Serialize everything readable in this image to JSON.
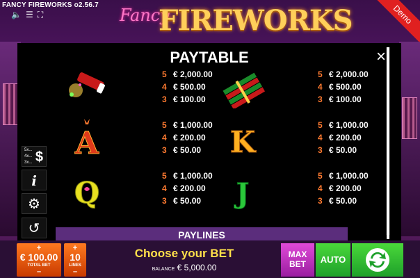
{
  "version": "FANCY FIREWORKS o2.56.7",
  "logo": {
    "fancy": "Fancy",
    "main": "FIREWORKS"
  },
  "demo": "Demo",
  "paytable": {
    "title": "PAYTABLE",
    "close": "×",
    "entries": [
      {
        "symbol": "firecracker",
        "pays": [
          {
            "n": "5",
            "amt": "€ 2,000.00"
          },
          {
            "n": "4",
            "amt": "€ 500.00"
          },
          {
            "n": "3",
            "amt": "€ 100.00"
          }
        ]
      },
      {
        "symbol": "rocket-bundle",
        "pays": [
          {
            "n": "5",
            "amt": "€ 2,000.00"
          },
          {
            "n": "4",
            "amt": "€ 500.00"
          },
          {
            "n": "3",
            "amt": "€ 100.00"
          }
        ]
      },
      {
        "symbol": "A",
        "pays": [
          {
            "n": "5",
            "amt": "€ 1,000.00"
          },
          {
            "n": "4",
            "amt": "€ 200.00"
          },
          {
            "n": "3",
            "amt": "€ 50.00"
          }
        ]
      },
      {
        "symbol": "K",
        "pays": [
          {
            "n": "5",
            "amt": "€ 1,000.00"
          },
          {
            "n": "4",
            "amt": "€ 200.00"
          },
          {
            "n": "3",
            "amt": "€ 50.00"
          }
        ]
      },
      {
        "symbol": "Q",
        "pays": [
          {
            "n": "5",
            "amt": "€ 1,000.00"
          },
          {
            "n": "4",
            "amt": "€ 200.00"
          },
          {
            "n": "3",
            "amt": "€ 50.00"
          }
        ]
      },
      {
        "symbol": "J",
        "pays": [
          {
            "n": "5",
            "amt": "€ 1,000.00"
          },
          {
            "n": "4",
            "amt": "€ 200.00"
          },
          {
            "n": "3",
            "amt": "€ 50.00"
          }
        ]
      }
    ],
    "paylines": "PAYLINES"
  },
  "side": {
    "multipliers": [
      "5x...",
      "4x...",
      "3x..."
    ],
    "dollar": "$",
    "info": "i"
  },
  "bottom": {
    "bet_value": "€ 100.00",
    "bet_caption": "TOTAL BET",
    "lines_value": "10",
    "lines_caption": "LINES",
    "plus": "+",
    "minus": "–",
    "message": "Choose your BET",
    "balance_label": "BALANCE",
    "balance_value": "€ 5,000.00",
    "max_line1": "MAX",
    "max_line2": "BET",
    "auto": "AUTO"
  },
  "colors": {
    "count": "#ff7a30",
    "message": "#ffe04a",
    "paylines_bar": "#5b2d7c"
  }
}
